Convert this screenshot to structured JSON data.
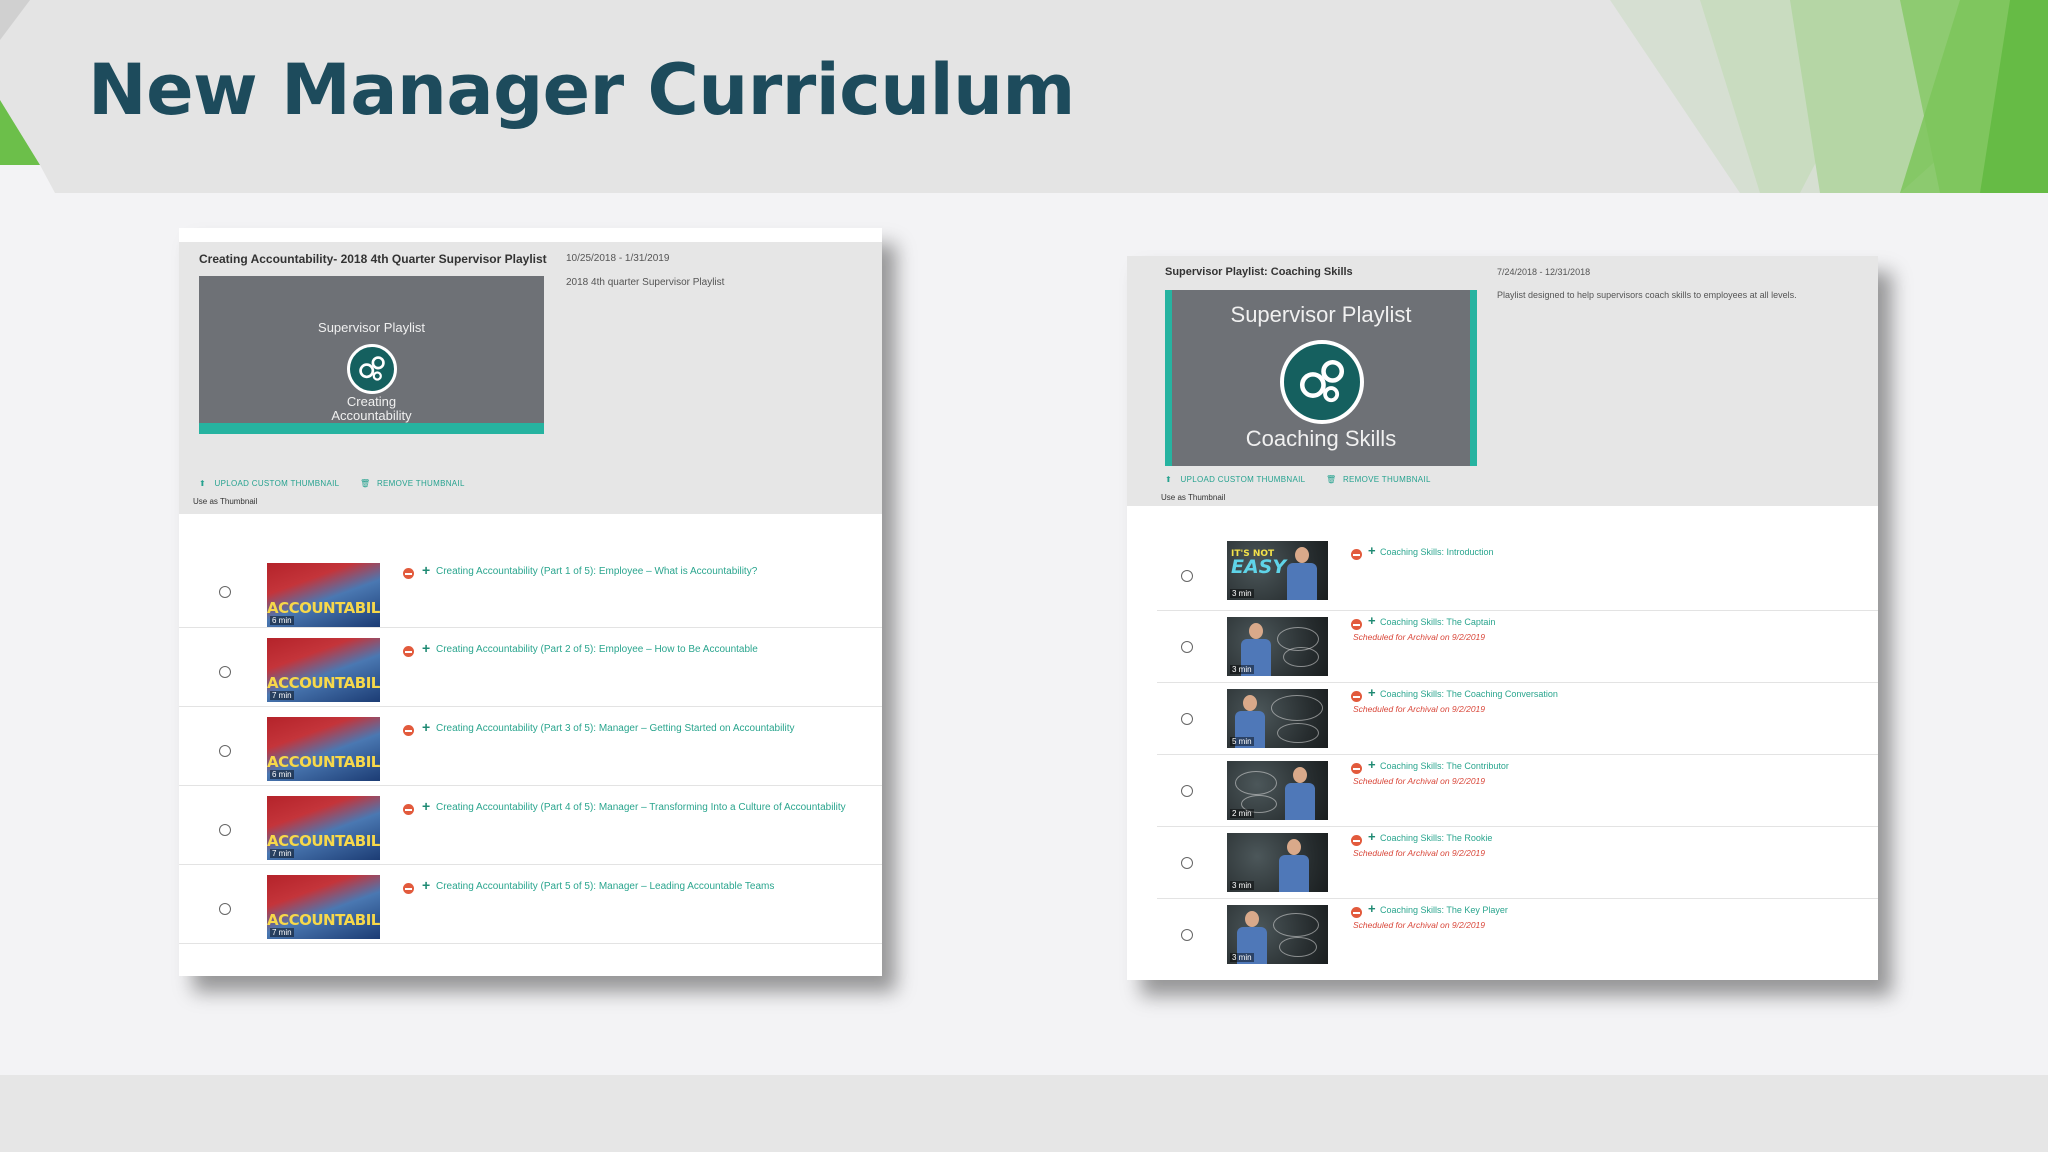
{
  "slide": {
    "title": "New Manager Curriculum",
    "colors": {
      "title": "#1d4b5c",
      "accent_green": "#6cbf4a",
      "teal": "#26b3a0"
    }
  },
  "left_panel": {
    "playlist_title": "Creating Accountability- 2018 4th Quarter Supervisor Playlist",
    "date_range": "10/25/2018 - 1/31/2019",
    "description": "2018 4th quarter Supervisor Playlist",
    "thumbnail": {
      "line1": "Supervisor Playlist",
      "line2": "Creating",
      "line3": "Accountability",
      "icon": "gears-icon"
    },
    "upload_label": "UPLOAD CUSTOM THUMBNAIL",
    "remove_label": "REMOVE THUMBNAIL",
    "use_as_thumbnail": "Use as Thumbnail",
    "videos": [
      {
        "title": "Creating Accountability (Part 1 of 5): Employee – What is Accountability?",
        "duration": "6 min",
        "thumb_word": "ACCOUNTABILITY"
      },
      {
        "title": "Creating Accountability (Part 2 of 5): Employee – How to Be Accountable",
        "duration": "7 min",
        "thumb_word": "ACCOUNTABILITY"
      },
      {
        "title": "Creating Accountability (Part 3 of 5): Manager – Getting Started on Accountability",
        "duration": "6 min",
        "thumb_word": "ACCOUNTABILITY"
      },
      {
        "title": "Creating Accountability (Part 4 of 5): Manager – Transforming Into a Culture of Accountability",
        "duration": "7 min",
        "thumb_word": "ACCOUNTABILITY"
      },
      {
        "title": "Creating Accountability (Part 5 of 5): Manager – Leading Accountable Teams",
        "duration": "7 min",
        "thumb_word": "ACCOUNTABILITY"
      }
    ]
  },
  "right_panel": {
    "playlist_title": "Supervisor Playlist: Coaching Skills",
    "date_range": "7/24/2018 - 12/31/2018",
    "description": "Playlist designed to help supervisors coach skills to employees at all levels.",
    "thumbnail": {
      "line1": "Supervisor Playlist",
      "line2": "Coaching Skills",
      "icon": "gears-icon"
    },
    "upload_label": "UPLOAD CUSTOM THUMBNAIL",
    "remove_label": "REMOVE THUMBNAIL",
    "use_as_thumbnail": "Use as Thumbnail",
    "videos": [
      {
        "title": "Coaching Skills: Introduction",
        "duration": "3 min",
        "scheduled": "",
        "easy_l1": "IT'S NOT",
        "easy_l2": "EASY"
      },
      {
        "title": "Coaching Skills: The Captain",
        "duration": "3 min",
        "scheduled": "Scheduled for Archival on 9/2/2019"
      },
      {
        "title": "Coaching Skills: The Coaching Conversation",
        "duration": "5 min",
        "scheduled": "Scheduled for Archival on 9/2/2019"
      },
      {
        "title": "Coaching Skills: The Contributor",
        "duration": "2 min",
        "scheduled": "Scheduled for Archival on 9/2/2019"
      },
      {
        "title": "Coaching Skills: The Rookie",
        "duration": "3 min",
        "scheduled": "Scheduled for Archival on 9/2/2019"
      },
      {
        "title": "Coaching Skills: The Key Player",
        "duration": "3 min",
        "scheduled": "Scheduled for Archival on 9/2/2019"
      }
    ]
  }
}
